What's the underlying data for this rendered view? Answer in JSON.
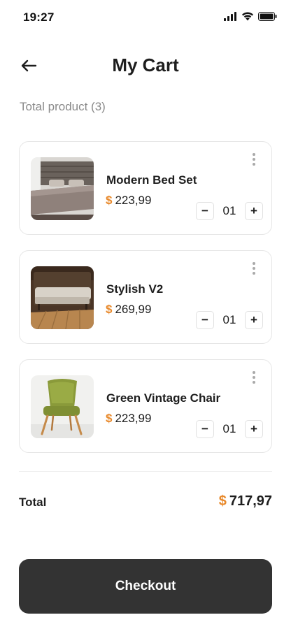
{
  "status": {
    "time": "19:27"
  },
  "header": {
    "title": "My Cart"
  },
  "summary": {
    "total_products_label": "Total product (3)"
  },
  "cart": {
    "items": [
      {
        "name": "Modern Bed Set",
        "currency": "$",
        "price": "223,99",
        "quantity": "01",
        "image": "bed-set-photo"
      },
      {
        "name": "Stylish V2",
        "currency": "$",
        "price": "269,99",
        "quantity": "01",
        "image": "sofa-bench-photo"
      },
      {
        "name": "Green Vintage Chair",
        "currency": "$",
        "price": "223,99",
        "quantity": "01",
        "image": "green-chair-photo"
      }
    ],
    "decrement_label": "−",
    "increment_label": "+"
  },
  "total": {
    "label": "Total",
    "currency": "$",
    "value": "717,97"
  },
  "checkout": {
    "label": "Checkout"
  },
  "colors": {
    "accent": "#e8892b",
    "button_dark": "#333333",
    "muted_text": "#8a8a8a"
  }
}
